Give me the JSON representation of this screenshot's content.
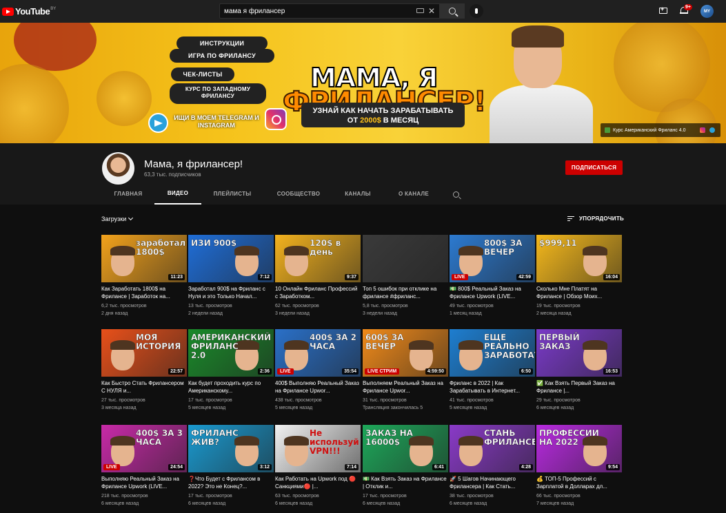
{
  "header": {
    "logo_text": "YouTube",
    "logo_region": "BY",
    "search_value": "мама я фрилансер",
    "avatar_initials": "MY",
    "notif_count": "9+"
  },
  "banner": {
    "pills": [
      "ИНСТРУКЦИИ",
      "ИГРА ПО ФРИЛАНСУ",
      "ЧЕК-ЛИСТЫ",
      "КУРС ПО ЗАПАДНОМУ ФРИЛАНСУ"
    ],
    "social_text": "ИЩИ В МОЕМ TELEGRAM И INSTAGRAM",
    "title_line1": "МАМА, Я",
    "title_line2": "ФРИЛАНСЕР!",
    "subtitle_a": "УЗНАЙ КАК НАЧАТЬ ЗАРАБАТЫВАТЬ",
    "subtitle_b": "ОТ",
    "subtitle_amount": "2000$",
    "subtitle_c": "В МЕСЯЦ",
    "link_label": "Курс Американский Фриланс 4.0"
  },
  "channel": {
    "name": "Мама, я фрилансер!",
    "subscribers": "63,3 тыс. подписчиков",
    "subscribe_label": "ПОДПИСАТЬСЯ",
    "tabs": [
      {
        "label": "ГЛАВНАЯ"
      },
      {
        "label": "ВИДЕО"
      },
      {
        "label": "ПЛЕЙЛИСТЫ"
      },
      {
        "label": "СООБЩЕСТВО"
      },
      {
        "label": "КАНАЛЫ"
      },
      {
        "label": "О КАНАЛЕ"
      }
    ]
  },
  "content": {
    "filter_label": "Загрузки",
    "sort_label": "УПОРЯДОЧИТЬ"
  },
  "videos": [
    {
      "title": "Как Заработать 1800$ на Фрилансе | Заработок на...",
      "views": "6,2 тыс. просмотров",
      "age": "2 дня назад",
      "duration": "11:23",
      "thumb_text": "заработал 1800$",
      "bg": "#f2a21c"
    },
    {
      "title": "Заработал 900$ на Фриланс с Нуля и это Только Начал...",
      "views": "13 тыс. просмотров",
      "age": "2 недели назад",
      "duration": "7:12",
      "thumb_text": "ИЗИ 900$",
      "bg": "#1f6ed8"
    },
    {
      "title": "10 Онлайн Фриланс Профессий с Заработком...",
      "views": "62 тыс. просмотров",
      "age": "3 недели назад",
      "duration": "9:37",
      "thumb_text": "120$ в день",
      "bg": "#f3b21e"
    },
    {
      "title": "Топ 5 ошибок при отклике на фрилансе #фриланс...",
      "views": "5,8 тыс. просмотров",
      "age": "3 недели назад",
      "duration": "",
      "thumb_text": "",
      "bg": "#3a3a3a"
    },
    {
      "title": "💵 800$ Реальный Заказ на Фрилансе Upwork (LIVE...",
      "views": "49 тыс. просмотров",
      "age": "1 месяц назад",
      "duration": "42:59",
      "thumb_text": "800$ ЗА ВЕЧЕР",
      "bg": "#2c7ad0",
      "live": "LIVE"
    },
    {
      "title": "Сколько Мне Платят на Фрилансе | Обзор Моих...",
      "views": "19 тыс. просмотров",
      "age": "2 месяца назад",
      "duration": "16:04",
      "thumb_text": "$999,11",
      "bg": "#f4b81c"
    },
    {
      "title": "Как Быстро Стать Фрилансером С НУЛЯ и...",
      "views": "27 тыс. просмотров",
      "age": "3 месяца назад",
      "duration": "22:57",
      "thumb_text": "МОЯ ИСТОРИЯ",
      "bg": "#e8501a"
    },
    {
      "title": "Как будет проходить курс по Американскому...",
      "views": "17 тыс. просмотров",
      "age": "5 месяцев назад",
      "duration": "2:36",
      "thumb_text": "АМЕРИКАНСКИЙ ФРИЛАНС 2.0",
      "bg": "#1a8a2a"
    },
    {
      "title": "400$ Выполняю Реальный Заказ на Фрилансе Upwor...",
      "views": "438 тыс. просмотров",
      "age": "5 месяцев назад",
      "duration": "35:54",
      "thumb_text": "400$ ЗА 2 ЧАСА",
      "bg": "#2a70c8",
      "live": "LIVE"
    },
    {
      "title": "Выполняем Реальный Заказ на Фрилансе Upwor...",
      "views": "31 тыс. просмотров",
      "age": "Трансляция закончилась 5",
      "duration": "4:59:50",
      "thumb_text": "600$ ЗА ВЕЧЕР",
      "bg": "#f08a1a",
      "live": "LIVE СТРИМ"
    },
    {
      "title": "Фриланс в 2022 | Как Зарабатывать в Интернет...",
      "views": "41 тыс. просмотров",
      "age": "5 месяцев назад",
      "duration": "6:50",
      "thumb_text": "ЕЩЕ РЕАЛЬНО ЗАРАБОТАТЬ?",
      "bg": "#1e7ed0"
    },
    {
      "title": "✅ Как Взять Первый Заказ на Фрилансе |...",
      "views": "29 тыс. просмотров",
      "age": "6 месяцев назад",
      "duration": "16:53",
      "thumb_text": "ПЕРВЫЙ ЗАКАЗ",
      "bg": "#7a3ac8"
    },
    {
      "title": "Выполняю Реальный Заказ на Фрилансе Upwork (LIVE...",
      "views": "218 тыс. просмотров",
      "age": "6 месяцев назад",
      "duration": "24:54",
      "thumb_text": "400$ ЗА 3 ЧАСА",
      "bg": "#c82aa8",
      "live": "LIVE"
    },
    {
      "title": "❓Что Будет с Фрилансом в 2022? Это не Конец?...",
      "views": "17 тыс. просмотров",
      "age": "6 месяцев назад",
      "duration": "3:12",
      "thumb_text": "ФРИЛАНС ЖИВ?",
      "bg": "#1a9ad0"
    },
    {
      "title": "Как Работать на Upwork под 🔴 Санкциями🔴 |...",
      "views": "63 тыс. просмотров",
      "age": "6 месяцев назад",
      "duration": "7:14",
      "thumb_text": "Не используй VPN!!!",
      "bg": "#f2f2f2"
    },
    {
      "title": "💵 Как Взять Заказ на Фрилансе | Отклик и...",
      "views": "17 тыс. просмотров",
      "age": "6 месяцев назад",
      "duration": "6:41",
      "thumb_text": "ЗАКАЗ НА 16000$",
      "bg": "#1ea85a"
    },
    {
      "title": "🚀 5 Шагов Начинающего Фрилансера | Как Стать...",
      "views": "38 тыс. просмотров",
      "age": "6 месяцев назад",
      "duration": "4:28",
      "thumb_text": "СТАНЬ ФРИЛАНСЕРОМ",
      "bg": "#8a3ac8"
    },
    {
      "title": "💰 ТОП-5 Профессий с Зарплатой в Долларах дл...",
      "views": "66 тыс. просмотров",
      "age": "7 месяцев назад",
      "duration": "9:54",
      "thumb_text": "ПРОФЕССИИ НА 2022",
      "bg": "#b82ae0"
    }
  ]
}
